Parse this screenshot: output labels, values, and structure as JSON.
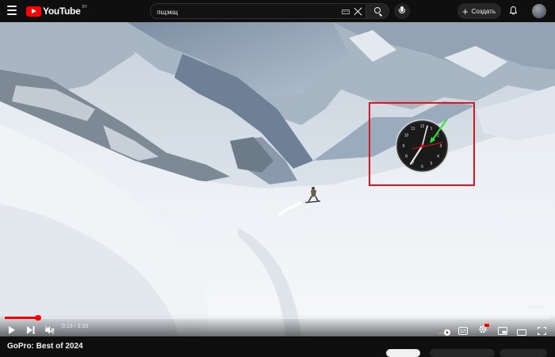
{
  "header": {
    "logo_text": "YouTube",
    "country_code": "BY",
    "search_value": "пщзкщ",
    "create_label": "Создать"
  },
  "player": {
    "current_time": "0:13",
    "duration": "3:33",
    "time_separator": " / ",
    "progress": 0.0604,
    "watermark": "GoPro",
    "muted": true
  },
  "video": {
    "title": "GoPro: Best of 2024"
  },
  "colors": {
    "accent": "#ff0000",
    "highlight_box": "#e0141c",
    "clock_second_hand": "#e0141c",
    "annotation_arrow": "#2ee62e"
  },
  "icons": [
    "menu-icon",
    "youtube-logo",
    "keyboard-icon",
    "clear-icon",
    "search-icon",
    "microphone-icon",
    "plus-icon",
    "bell-icon",
    "avatar",
    "play-icon",
    "next-icon",
    "mute-icon",
    "autoplay-toggle",
    "subtitles-icon",
    "settings-icon",
    "miniplayer-icon",
    "theater-icon",
    "fullscreen-icon"
  ]
}
